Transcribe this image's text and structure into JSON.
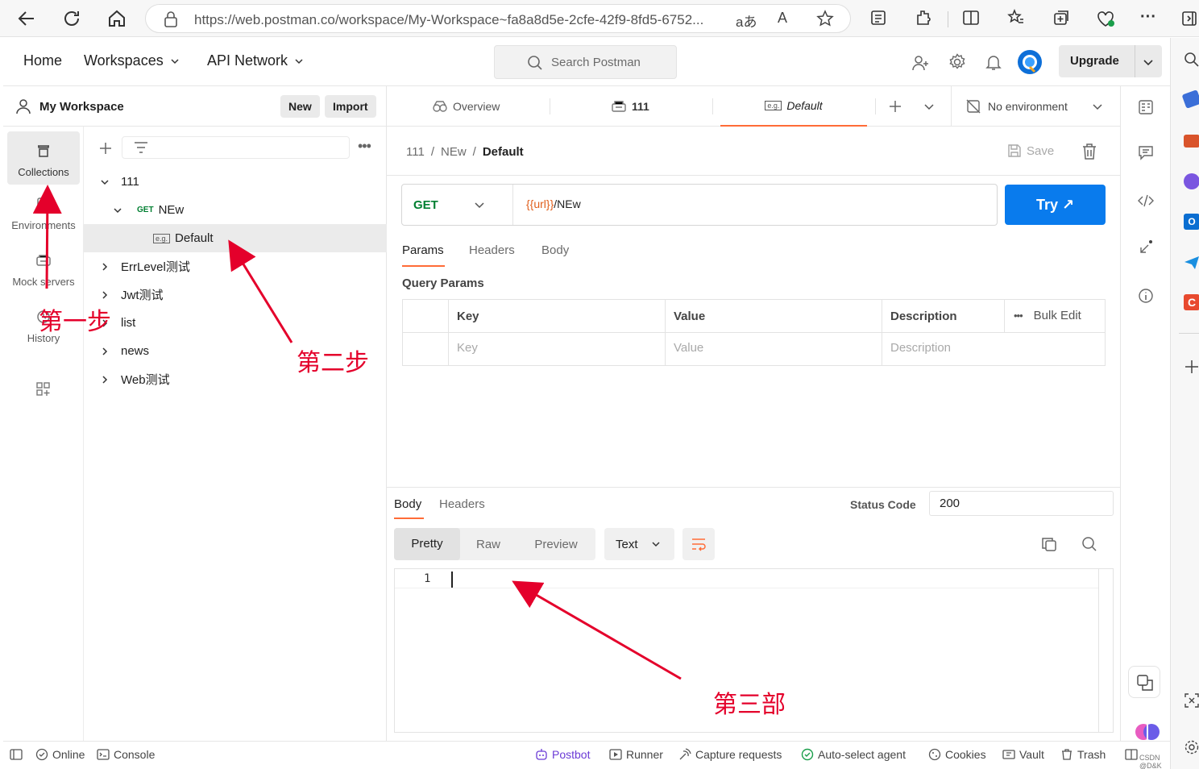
{
  "browser": {
    "url": "https://web.postman.co/workspace/My-Workspace~fa8a8d5e-2cfe-42f9-8fd5-6752...",
    "read_aloud": "aあ",
    "aa": "A"
  },
  "header": {
    "nav": [
      "Home",
      "Workspaces",
      "API Network"
    ],
    "search_placeholder": "Search Postman",
    "upgrade": "Upgrade"
  },
  "workspace": {
    "title": "My Workspace",
    "new_btn": "New",
    "import_btn": "Import"
  },
  "rail": [
    {
      "label": "Collections",
      "icon": "collections-icon"
    },
    {
      "label": "Environments",
      "icon": "environments-icon"
    },
    {
      "label": "Mock servers",
      "icon": "mock-servers-icon"
    },
    {
      "label": "History",
      "icon": "history-icon"
    }
  ],
  "tree": {
    "root": "111",
    "folder_method": "GET",
    "folder": "NEw",
    "example_badge": "e.g.",
    "example": "Default",
    "collections": [
      "ErrLevel测试",
      "Jwt测试",
      "list",
      "news",
      "Web测试"
    ]
  },
  "tabs": {
    "overview": "Overview",
    "collection": "111",
    "active": "Default",
    "environment": "No environment"
  },
  "breadcrumb": {
    "c1": "111",
    "c2": "NEw",
    "c3": "Default",
    "save": "Save"
  },
  "request": {
    "method": "GET",
    "url_var": "{{url}}",
    "url_path": "/NEw",
    "try": "Try ↗"
  },
  "req_tabs": [
    "Params",
    "Headers",
    "Body"
  ],
  "params": {
    "title": "Query Params",
    "headers": [
      "Key",
      "Value",
      "Description"
    ],
    "bulk_edit": "Bulk Edit",
    "placeholders": [
      "Key",
      "Value",
      "Description"
    ]
  },
  "response": {
    "tabs": [
      "Body",
      "Headers"
    ],
    "status_label": "Status Code",
    "status_value": "200",
    "views": [
      "Pretty",
      "Raw",
      "Preview"
    ],
    "format": "Text",
    "line_no": "1"
  },
  "statusbar": {
    "online": "Online",
    "console": "Console",
    "postbot": "Postbot",
    "runner": "Runner",
    "capture": "Capture requests",
    "agent": "Auto-select agent",
    "cookies": "Cookies",
    "vault": "Vault",
    "trash": "Trash",
    "watermark": "CSDN @D&K"
  },
  "annotations": {
    "step1": "第一步",
    "step2": "第二步",
    "step3": "第三部"
  },
  "colors": {
    "accent_orange": "#ff6c37",
    "get_green": "#007f31",
    "try_blue": "#097bed",
    "annotation_red": "#e4002b",
    "url_var_orange": "#e05e1b"
  }
}
